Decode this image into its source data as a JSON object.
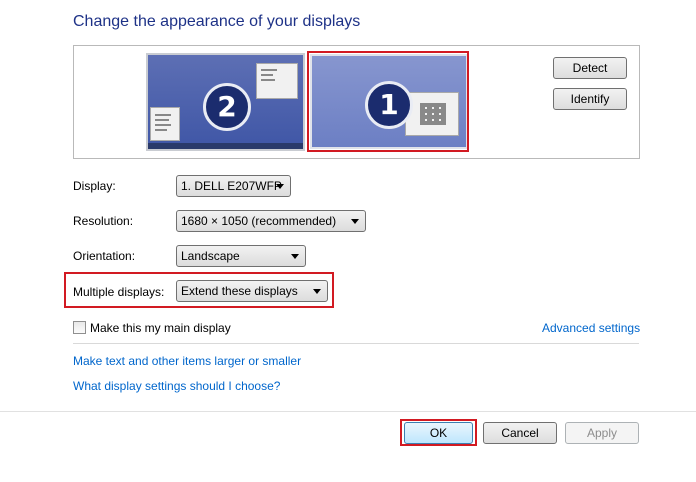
{
  "title": "Change the appearance of your displays",
  "preview": {
    "monitors": [
      {
        "number": "2",
        "selected": false
      },
      {
        "number": "1",
        "selected": true
      }
    ],
    "detect_label": "Detect",
    "identify_label": "Identify"
  },
  "form": {
    "display_label": "Display:",
    "display_value": "1. DELL E207WFP",
    "resolution_label": "Resolution:",
    "resolution_value": "1680 × 1050 (recommended)",
    "orientation_label": "Orientation:",
    "orientation_value": "Landscape",
    "multiple_label": "Multiple displays:",
    "multiple_value": "Extend these displays",
    "main_display_label": "Make this my main display",
    "main_display_checked": false,
    "advanced_link": "Advanced settings"
  },
  "links": {
    "text_size": "Make text and other items larger or smaller",
    "help": "What display settings should I choose?"
  },
  "footer": {
    "ok_label": "OK",
    "cancel_label": "Cancel",
    "apply_label": "Apply"
  },
  "colors": {
    "highlight": "#d21a22",
    "link": "#0066cc",
    "title": "#1e3287"
  }
}
